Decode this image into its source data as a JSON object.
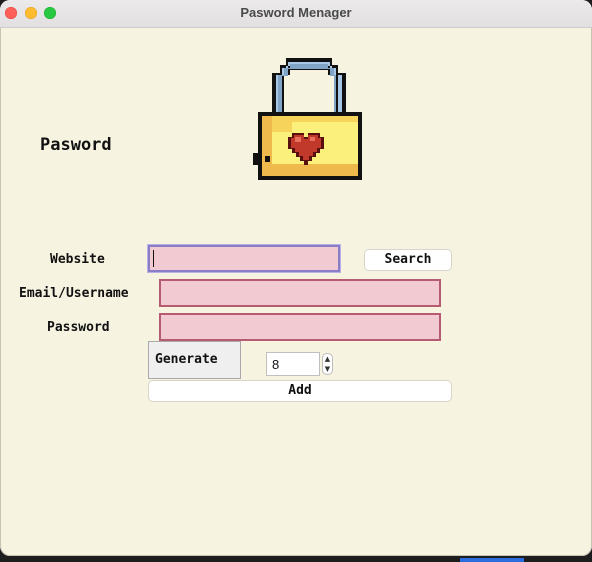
{
  "window": {
    "title": "Pasword Menager"
  },
  "app_label": "Pasword",
  "logo": {
    "name": "padlock-with-heart",
    "colors": {
      "shackle": "#a9c8e6",
      "body": "#fbf07c",
      "heart": "#c0392b",
      "outline": "#111111"
    }
  },
  "form": {
    "website_label": "Website",
    "email_label": "Email/Username",
    "password_label": "Password",
    "website_value": "",
    "email_value": "",
    "password_value": "",
    "search_label": "Search",
    "generate_label": "Generate",
    "length_value": "8",
    "add_label": "Add"
  },
  "colors": {
    "background": "#f7f3e1",
    "field_bg": "#f2cad2",
    "field_border": "#b65b72",
    "focus_border": "#8b7ec8"
  }
}
